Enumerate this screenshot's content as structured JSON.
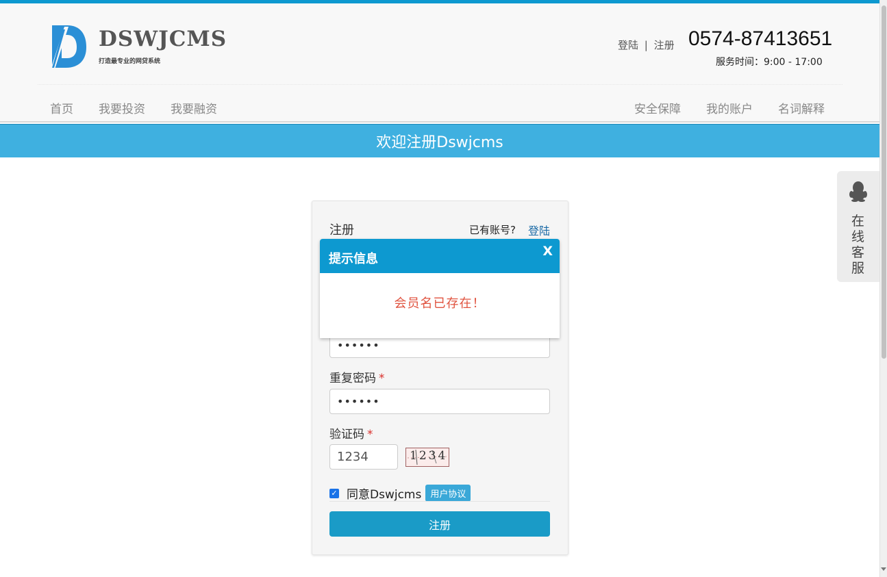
{
  "header": {
    "logo_text": "DSWJCMS",
    "logo_slogan": "打造最专业的网贷系统",
    "login_label": "登陆",
    "separator": "|",
    "register_label": "注册",
    "phone": "0574-87413651",
    "service_time": "服务时间：9:00 - 17:00"
  },
  "nav": {
    "left": [
      "首页",
      "我要投资",
      "我要融资"
    ],
    "right": [
      "安全保障",
      "我的账户",
      "名词解释"
    ]
  },
  "banner": {
    "title": "欢迎注册Dswjcms"
  },
  "form": {
    "title": "注册",
    "has_account": "已有账号?",
    "login_link": "登陆",
    "password_value": "••••••",
    "repeat_password_label": "重复密码",
    "repeat_password_value": "••••••",
    "required_mark": "*",
    "captcha_label": "验证码",
    "captcha_value": "1234",
    "captcha_image_text": "1234",
    "agree_checked": true,
    "agree_text": "同意Dswjcms",
    "agreement_link": "用户协议",
    "submit_label": "注册"
  },
  "modal": {
    "title": "提示信息",
    "close_label": "X",
    "message": "会员名已存在！"
  },
  "customer_service": {
    "label": [
      "在",
      "线",
      "客",
      "服"
    ]
  },
  "colors": {
    "accent": "#0d99d0",
    "banner": "#3fb0e0",
    "error": "#e0533f",
    "required": "#d9302c"
  }
}
